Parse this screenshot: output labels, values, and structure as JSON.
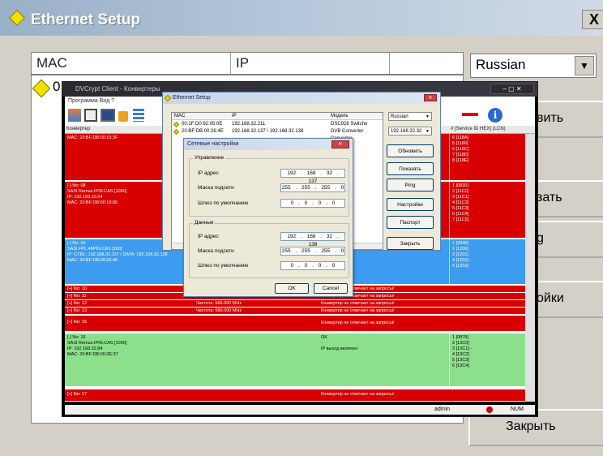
{
  "big": {
    "title": "Ethernet Setup",
    "close": "X",
    "col_mac": "MAC",
    "col_ip": "IP",
    "row_frag": "0",
    "language": "Russian",
    "btn1": "вить",
    "btn2": "зать",
    "btn3": "g",
    "btn4": "ойки",
    "btn5": "Закрыть"
  },
  "client": {
    "title": "DVCrypt Client - Конвертеры",
    "menu": "Программа   Вид   ?",
    "hdr_conv": "Конвертер",
    "hdr_service": "# [Service ID HEX] (LCN)",
    "status_user": "admin",
    "status_num": "NUM",
    "rows": [
      {
        "l": "MAC: 20:BF:DB:00:15:3F",
        "r": "6 [118A]\n5 [1189]\n6 [118C]\n7 [118D]\n8 [118E]"
      },
      {
        "l": "[-] No: 08\nSASI Remux.IPIN.CAS [1000]\nIP: 192.168.33.54\nMAC: 20:BF:DB:00:10:85",
        "r": "1 [0830]\n2 [11C0]\n3 [11C1]\n4 [11C2]\n5 [11C3]\n6 [11C4]\n7 [11C5]"
      },
      {
        "l": "[-] No: 09\nSASI.FPL.48PIN.CAS [100]\nIP: CTRL: 192.168.32.137 / DATA: 192.168.32.138\nMAC: 20:BF:DB:00:26:4E",
        "r": "1 [0840]\n2 [1200]\n3 [1201]\n4 [1202] -\n5 [1203]"
      },
      {
        "l": "[+] No: 10",
        "m": "Конвертер не отвечает на запросы!"
      },
      {
        "l": "[+] No: 11",
        "m": "Конвертер не отвечает на запросы!"
      },
      {
        "l": "[+] No: 12",
        "c": "Частота: 666.000 MHz",
        "m": "Конвертер не отвечает на запросы!"
      },
      {
        "l": "[+] No: 13",
        "c": "Частота: 690.000 MHz",
        "m": "Конвертер не отвечает на запросы!"
      },
      {
        "l": "[+] No: 15",
        "m": "Конвертер не отвечает на запросы!"
      },
      {
        "l": "[-] No: 16\nSASI Remux.IPIN.CAS [1000]\nIP: 192.168.32.84\nMAC: 20:BF:DB:00:2E:37",
        "m": "OK\n-\nIP выход включен",
        "r": "1 [0878]\n2 [13C0]\n3 [13C1] -\n4 [13C2]\n5 [13C3]\n6 [13C4]"
      },
      {
        "l": "[+] No: 17",
        "m": "Конвертер не отвечает на запросы!"
      }
    ]
  },
  "eth": {
    "title": "Ethernet Setup",
    "col_mac": "MAC",
    "col_ip": "IP",
    "col_model": "Модель",
    "rows": [
      {
        "mac": "00:1F:D0:92:05:0E",
        "ip": "192.168.32.211",
        "model": "DSC928 Switche"
      },
      {
        "mac": "20:BF:DB:00:26:4E",
        "ip": "192.168.32.137 / 192.168.32.138",
        "model": "DVB Converter"
      },
      {
        "mac": "",
        "ip": "",
        "model": "Converter"
      }
    ],
    "language": "Russian",
    "ip_select": "192.168.32.32",
    "btn_refresh": "Обновить",
    "btn_show": "Показать",
    "btn_ping": "Ping",
    "btn_settings": "Настройки",
    "btn_passport": "Паспорт",
    "btn_close": "Закрыть"
  },
  "net": {
    "title": "Сетевые настройки",
    "grp_ctrl": "Управление",
    "grp_data": "Данные",
    "lbl_ip": "IP адрес",
    "lbl_mask": "Маска подсети",
    "lbl_gw": "Шлюз по умолчанию",
    "ctrl_ip": "192 . 168 . 32 . 137",
    "ctrl_mask": "255 . 255 . 255 . 0",
    "ctrl_gw": "0 . 0 . 0 . 0",
    "data_ip": "192 . 168 . 32 . 138",
    "data_mask": "255 . 255 . 255 . 0",
    "data_gw": "0 . 0 . 0 . 0",
    "ok": "OK",
    "cancel": "Cancel"
  }
}
